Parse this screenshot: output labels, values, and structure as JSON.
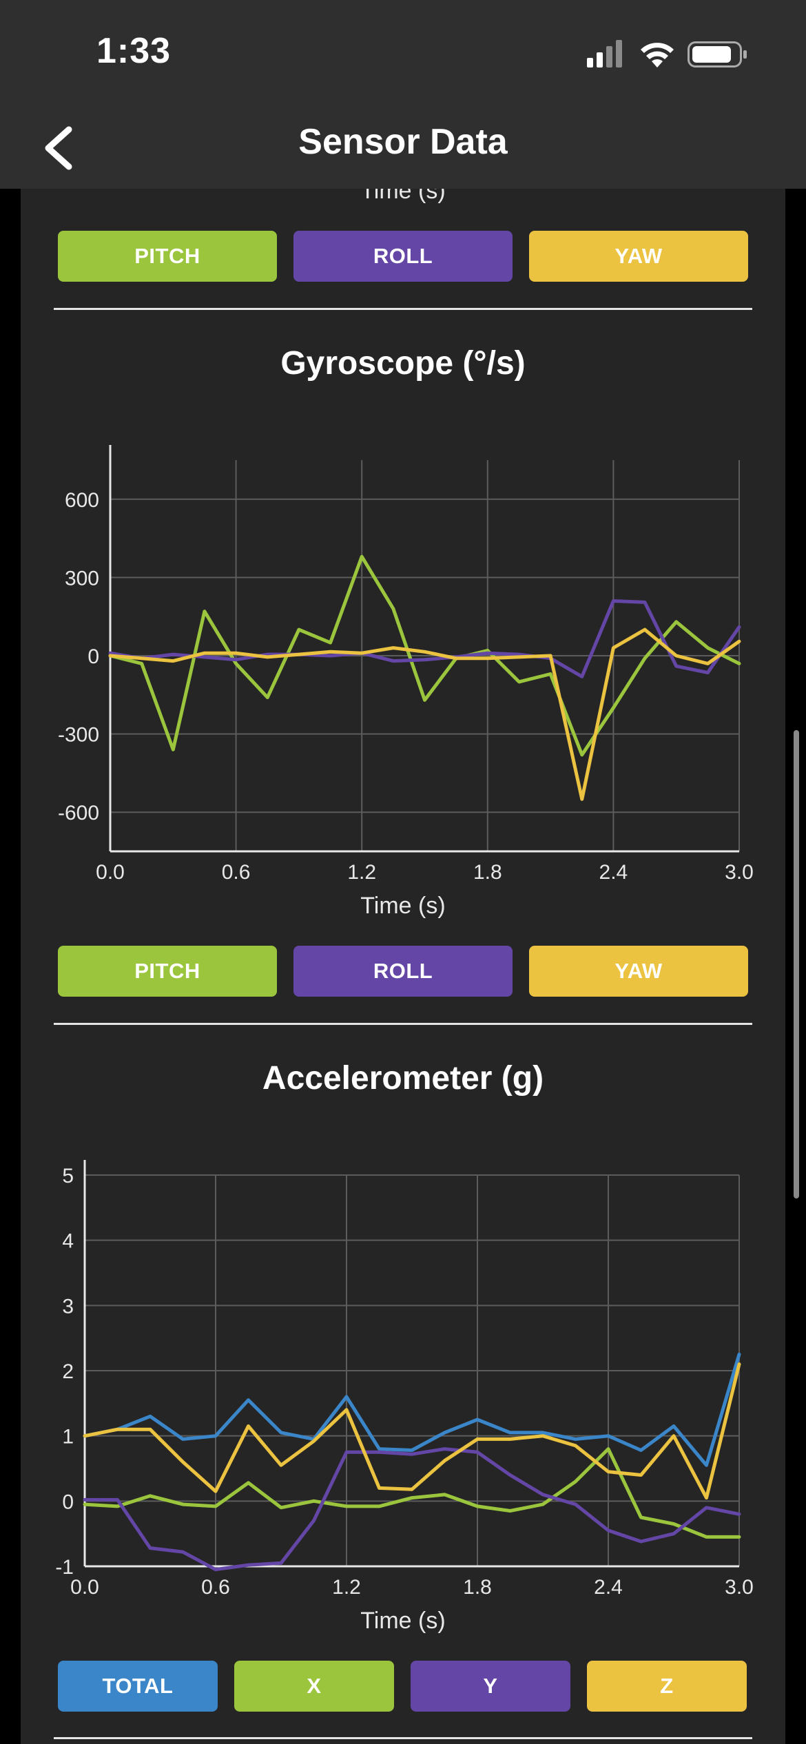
{
  "status_bar": {
    "time": "1:33"
  },
  "nav": {
    "title": "Sensor Data"
  },
  "top_partial": {
    "x_axis_label": "Time (s)",
    "legend": [
      {
        "label": "PITCH",
        "color": "#9bc53d"
      },
      {
        "label": "ROLL",
        "color": "#6446a6"
      },
      {
        "label": "YAW",
        "color": "#ebc340"
      }
    ]
  },
  "gyro": {
    "title": "Gyroscope (°/s)",
    "legend": [
      {
        "label": "PITCH",
        "color": "#9bc53d"
      },
      {
        "label": "ROLL",
        "color": "#6446a6"
      },
      {
        "label": "YAW",
        "color": "#ebc340"
      }
    ]
  },
  "accel": {
    "title": "Accelerometer (g)",
    "legend": [
      {
        "label": "TOTAL",
        "color": "#3a86c8"
      },
      {
        "label": "X",
        "color": "#9bc53d"
      },
      {
        "label": "Y",
        "color": "#6446a6"
      },
      {
        "label": "Z",
        "color": "#ebc340"
      }
    ]
  },
  "chart_data": [
    {
      "type": "line",
      "title": "Gyroscope (°/s)",
      "xlabel": "Time (s)",
      "ylabel": "",
      "xlim": [
        0,
        3.0
      ],
      "ylim": [
        -750,
        750
      ],
      "x_ticks": [
        "0.0",
        "0.6",
        "1.2",
        "1.8",
        "2.4",
        "3.0"
      ],
      "y_ticks": [
        "600",
        "300",
        "0",
        "-300",
        "-600"
      ],
      "grid": true,
      "x": [
        0,
        0.15,
        0.3,
        0.45,
        0.6,
        0.75,
        0.9,
        1.05,
        1.2,
        1.35,
        1.5,
        1.65,
        1.8,
        1.95,
        2.1,
        2.25,
        2.4,
        2.55,
        2.7,
        2.85,
        3.0
      ],
      "series": [
        {
          "name": "PITCH",
          "color": "#9bc53d",
          "values": [
            0,
            -30,
            -360,
            170,
            -30,
            -160,
            100,
            50,
            380,
            180,
            -170,
            -10,
            20,
            -100,
            -70,
            -380,
            -200,
            -10,
            130,
            30,
            -30
          ]
        },
        {
          "name": "ROLL",
          "color": "#6446a6",
          "values": [
            10,
            -10,
            5,
            -5,
            -15,
            5,
            5,
            0,
            10,
            -20,
            -15,
            -5,
            10,
            5,
            -10,
            -80,
            210,
            205,
            -40,
            -65,
            110
          ]
        },
        {
          "name": "YAW",
          "color": "#ebc340",
          "values": [
            0,
            -10,
            -20,
            10,
            10,
            -5,
            5,
            15,
            10,
            30,
            15,
            -10,
            -10,
            -5,
            0,
            -550,
            30,
            100,
            0,
            -30,
            55
          ]
        }
      ]
    },
    {
      "type": "line",
      "title": "Accelerometer (g)",
      "xlabel": "Time (s)",
      "ylabel": "",
      "xlim": [
        0,
        3.0
      ],
      "ylim": [
        -1.0,
        5.0
      ],
      "x_ticks": [
        "0.0",
        "0.6",
        "1.2",
        "1.8",
        "2.4",
        "3.0"
      ],
      "y_ticks": [
        "5",
        "4",
        "3",
        "2",
        "1",
        "0",
        "-1"
      ],
      "grid": true,
      "x": [
        0,
        0.15,
        0.3,
        0.45,
        0.6,
        0.75,
        0.9,
        1.05,
        1.2,
        1.35,
        1.5,
        1.65,
        1.8,
        1.95,
        2.1,
        2.25,
        2.4,
        2.55,
        2.7,
        2.85,
        3.0
      ],
      "series": [
        {
          "name": "TOTAL",
          "color": "#3a86c8",
          "values": [
            1.0,
            1.1,
            1.3,
            0.95,
            1.0,
            1.55,
            1.05,
            0.95,
            1.6,
            0.8,
            0.78,
            1.05,
            1.25,
            1.05,
            1.05,
            0.95,
            1.0,
            0.78,
            1.15,
            0.55,
            2.25
          ]
        },
        {
          "name": "X",
          "color": "#9bc53d",
          "values": [
            -0.05,
            -0.08,
            0.08,
            -0.05,
            -0.08,
            0.28,
            -0.1,
            0.0,
            -0.08,
            -0.08,
            0.05,
            0.1,
            -0.08,
            -0.15,
            -0.05,
            0.3,
            0.8,
            -0.25,
            -0.35,
            -0.55,
            -0.55
          ]
        },
        {
          "name": "Y",
          "color": "#6446a6",
          "values": [
            0.02,
            0.02,
            -0.72,
            -0.78,
            -1.05,
            -0.98,
            -0.95,
            -0.3,
            0.75,
            0.75,
            0.72,
            0.8,
            0.75,
            0.4,
            0.1,
            -0.05,
            -0.45,
            -0.62,
            -0.5,
            -0.1,
            -0.2
          ]
        },
        {
          "name": "Z",
          "color": "#ebc340",
          "values": [
            1.0,
            1.1,
            1.1,
            0.6,
            0.15,
            1.15,
            0.55,
            0.92,
            1.4,
            0.2,
            0.18,
            0.62,
            0.95,
            0.95,
            1.0,
            0.85,
            0.45,
            0.4,
            1.0,
            0.05,
            2.1
          ]
        }
      ]
    }
  ]
}
